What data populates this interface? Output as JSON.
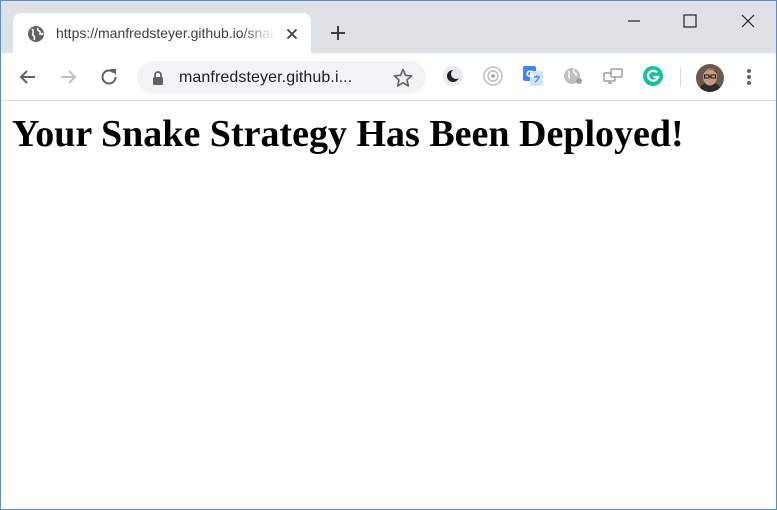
{
  "browser": {
    "tab": {
      "title": "https://manfredsteyer.github.io/snake",
      "favicon": "globe-icon"
    },
    "omnibox": {
      "url": "manfredsteyer.github.i..."
    },
    "extensions": [
      "dark-mode-icon",
      "target-icon",
      "google-translate-icon",
      "globe-extension-icon",
      "screens-icon",
      "grammarly-icon"
    ],
    "colors": {
      "tabstrip": "#dee1e6",
      "omnibox": "#f1f3f4",
      "grammarly": "#15c39a",
      "translate": "#4285f4"
    }
  },
  "page": {
    "heading": "Your Snake Strategy Has Been Deployed!"
  }
}
